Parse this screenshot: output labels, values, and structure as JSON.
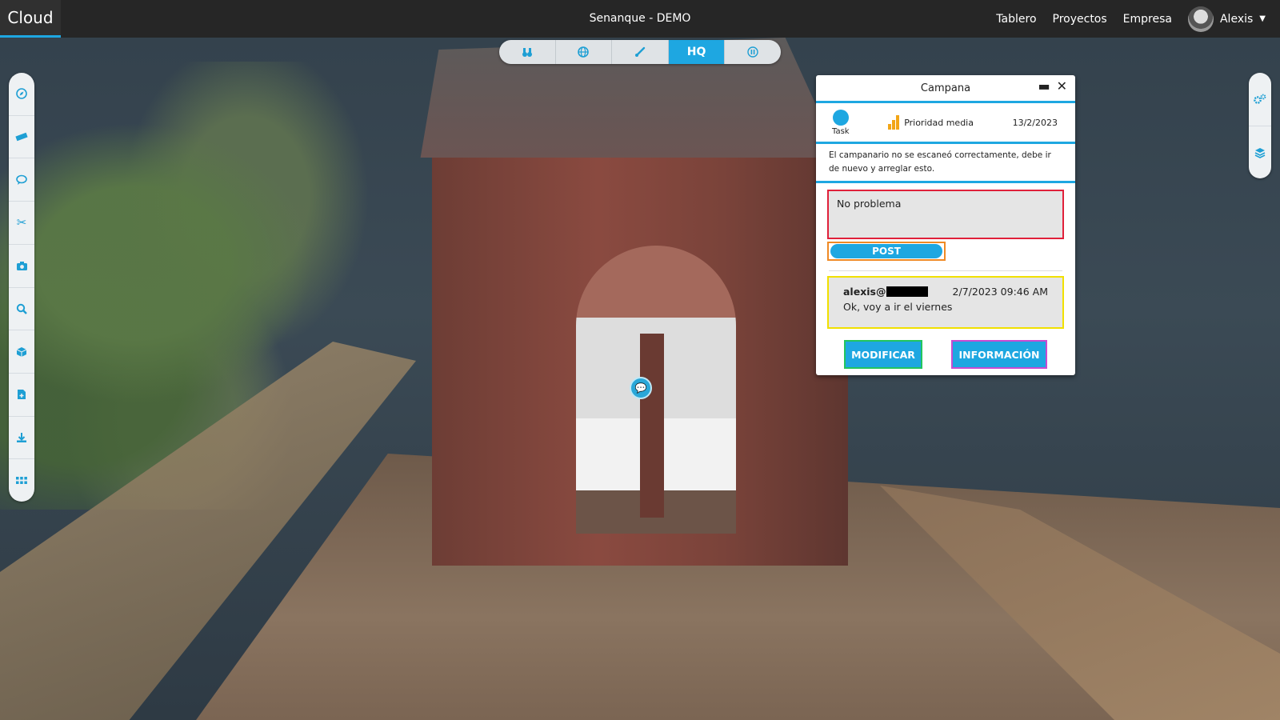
{
  "app": {
    "brand": "Cloud",
    "title": "Senanque - DEMO"
  },
  "nav": {
    "items": [
      "Tablero",
      "Proyectos",
      "Empresa"
    ],
    "user_name": "Alexis"
  },
  "view_toolbar": {
    "buttons": [
      {
        "icon": "binoculars-icon"
      },
      {
        "icon": "globe-icon"
      },
      {
        "icon": "brush-icon"
      },
      {
        "label": "HQ",
        "active": true
      },
      {
        "icon": "pause-icon"
      }
    ]
  },
  "left_tools": [
    "compass-icon",
    "ruler-icon",
    "comment-icon",
    "scissors-icon",
    "camera-icon",
    "search-icon",
    "cube-icon",
    "file-add-icon",
    "download-icon",
    "grid-icon"
  ],
  "right_tools": [
    "settings-icon",
    "layers-icon"
  ],
  "issue_panel": {
    "title": "Campana",
    "type_label": "Task",
    "priority_label": "Prioridad media",
    "date": "13/2/2023",
    "description": "El campanario no se escaneó correctamente, debe ir de nuevo y arreglar esto.",
    "reply_value": "No problema",
    "post_label": "POST",
    "comment": {
      "user": "alexis@",
      "timestamp": "2/7/2023 09:46 AM",
      "text": "Ok, voy a ir el viernes"
    },
    "modify_label": "MODIFICAR",
    "info_label": "INFORMACIÓN"
  },
  "colors": {
    "accent": "#1ea7e1",
    "reply_border": "#e0203a",
    "post_border": "#f08a24",
    "comment_border": "#f1e000",
    "modify_border": "#22c55e",
    "info_border": "#c94bd1",
    "priority": "#f2a516"
  }
}
